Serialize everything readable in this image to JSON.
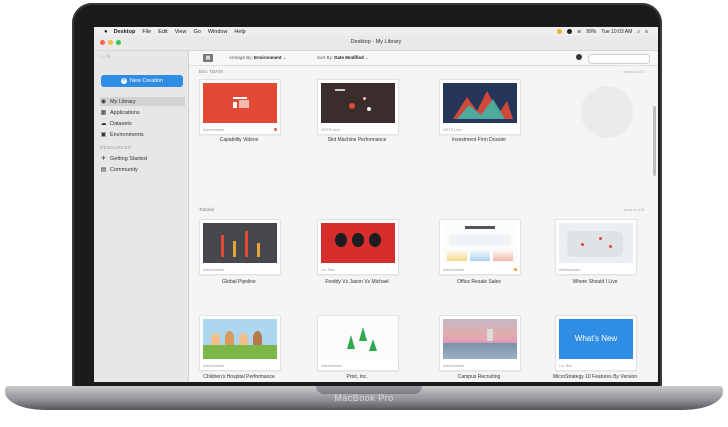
{
  "menubar": {
    "apple": "",
    "app": "Desktop",
    "items": [
      "File",
      "Edit",
      "View",
      "Go",
      "Window",
      "Help"
    ],
    "status": "99%",
    "clock": "Tue 10:03 AM"
  },
  "window": {
    "title": "Desktop - My Library"
  },
  "sidebar": {
    "new_button": "New Creation",
    "items": [
      {
        "label": "My Library",
        "icon": "library-icon"
      },
      {
        "label": "Applications",
        "icon": "applications-icon"
      },
      {
        "label": "Datasets",
        "icon": "datasets-icon"
      },
      {
        "label": "Environments",
        "icon": "environments-icon"
      }
    ],
    "section": "RESOURCES",
    "resources": [
      {
        "label": "Getting Started",
        "icon": "rocket-icon"
      },
      {
        "label": "Community",
        "icon": "community-icon"
      }
    ]
  },
  "toolbar": {
    "arrange_label": "Arrange By:",
    "arrange_value": "Environment",
    "sort_label": "Sort By:",
    "sort_value": "Date Modified"
  },
  "sections": [
    {
      "label": "Env: TDATA",
      "link": "show 4 of 6"
    },
    {
      "label": "Tutorial",
      "link": "show 4 of 8"
    }
  ],
  "cards": [
    {
      "caption": "Capability Videos",
      "owner": "Administrator"
    },
    {
      "caption": "Slot Machine Performance",
      "owner": "MSTR User"
    },
    {
      "caption": "Investment Firm Dossier",
      "owner": "MSTR User"
    },
    {
      "caption": "Global Pipeline",
      "owner": "Administrator"
    },
    {
      "caption": "Freddy Vs Jason Vs Michael",
      "owner": "Liu, Sam"
    },
    {
      "caption": "Office Resale Sales",
      "owner": "Administrator"
    },
    {
      "caption": "Where Should I Live",
      "owner": "Administrator"
    },
    {
      "caption": "Children's Hospital Performance",
      "owner": "Administrator"
    },
    {
      "caption": "Print, Inc.",
      "owner": "Administrator"
    },
    {
      "caption": "Campus Recruiting",
      "owner": "Administrator"
    },
    {
      "caption": "MicroStrategy 10 Features By Version",
      "owner": "Liu, Ben"
    }
  ],
  "whats_new": "What's New",
  "laptop": {
    "label": "MacBook Pro"
  },
  "colors": {
    "accent": "#2f8de4",
    "red_thumb": "#e34a35",
    "chart_bg": "#27355a"
  }
}
